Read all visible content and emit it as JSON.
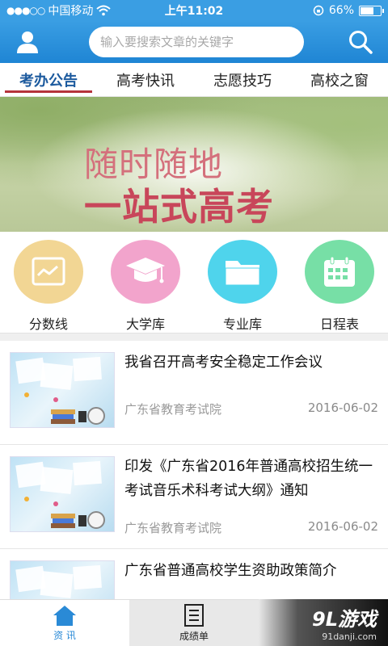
{
  "status_bar": {
    "carrier": "中国移动",
    "time": "上午11:02",
    "battery_percent": "66%",
    "battery_level": 0.66
  },
  "header": {
    "user_icon": "user-icon",
    "search_placeholder": "输入要搜索文章的关键字",
    "search_icon": "search-icon"
  },
  "tabs": [
    {
      "label": "考办公告",
      "active": true
    },
    {
      "label": "高考快讯",
      "active": false
    },
    {
      "label": "志愿技巧",
      "active": false
    },
    {
      "label": "高校之窗",
      "active": false
    }
  ],
  "banner": {
    "line1": "随时随地",
    "line2": "一站式高考"
  },
  "quick_links": [
    {
      "label": "分数线",
      "icon": "chart-icon",
      "color": "#f2d694"
    },
    {
      "label": "大学库",
      "icon": "graduation-cap-icon",
      "color": "#f2a4cc"
    },
    {
      "label": "专业库",
      "icon": "folder-icon",
      "color": "#4fd4ec"
    },
    {
      "label": "日程表",
      "icon": "calendar-icon",
      "color": "#77dfa6"
    }
  ],
  "news": [
    {
      "title": "我省召开高考安全稳定工作会议",
      "source": "广东省教育考试院",
      "date": "2016-06-02"
    },
    {
      "title": "印发《广东省2016年普通高校招生统一考试音乐术科考试大纲》通知",
      "source": "广东省教育考试院",
      "date": "2016-06-02"
    },
    {
      "title": "广东省普通高校学生资助政策简介",
      "source": "",
      "date": ""
    }
  ],
  "bottom_nav": [
    {
      "label": "资 讯",
      "icon": "home-icon",
      "active": true
    },
    {
      "label": "成绩单",
      "icon": "list-icon",
      "active": false
    }
  ],
  "watermark": {
    "brand": "9L游戏",
    "url": "91danji.com"
  },
  "colors": {
    "primary": "#2a8ad6",
    "tab_underline": "#b5333b"
  }
}
